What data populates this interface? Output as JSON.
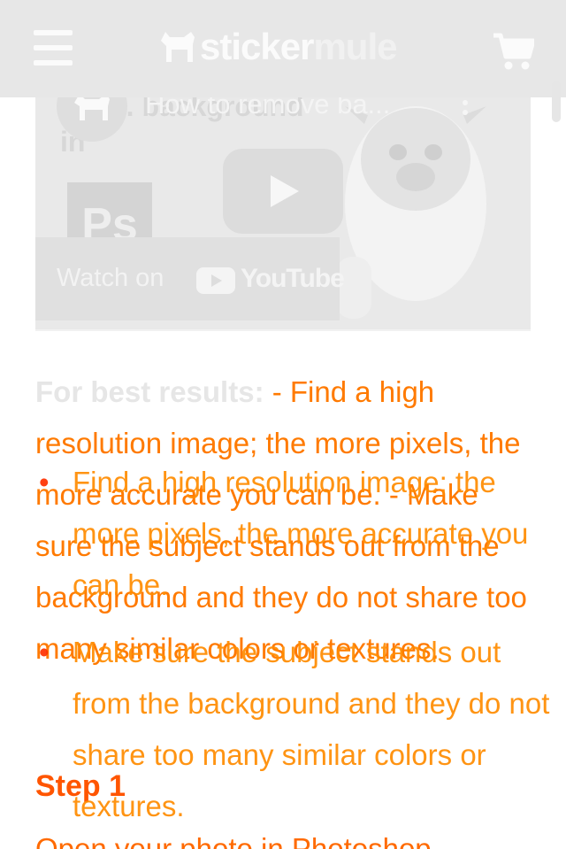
{
  "header": {
    "logo_sticker": "sticker",
    "logo_mule": "mule",
    "icons": [
      "menu-icon",
      "mule-logo-icon",
      "cart-icon"
    ]
  },
  "video": {
    "title": "How to remove ba...",
    "background_title": "the ... background in",
    "ps_label": "Ps",
    "watch_on": "Watch on",
    "youtube": "YouTube",
    "icons": [
      "channel-avatar-icon",
      "more-options-icon",
      "play-icon",
      "youtube-logo-icon"
    ]
  },
  "article": {
    "best_results_label": "For best results:",
    "best_results_text": " - Find a high resolution image; the more pixels, the more accurate you can be. - Make sure the subject stands out from the background and they do not share too many similar colors or textures.",
    "tips": [
      "Find a high resolution image; the more pixels, the more accurate you can be.",
      "Make sure the subject stands out from the background and they do not share too many similar colors or textures."
    ],
    "step1_heading": "Step 1",
    "step1_text": "Open your photo in Photoshop."
  },
  "colors": {
    "header_bg": "#e7e7e7",
    "accent_orange": "#ff7a00",
    "accent_red": "#ff2a00"
  }
}
